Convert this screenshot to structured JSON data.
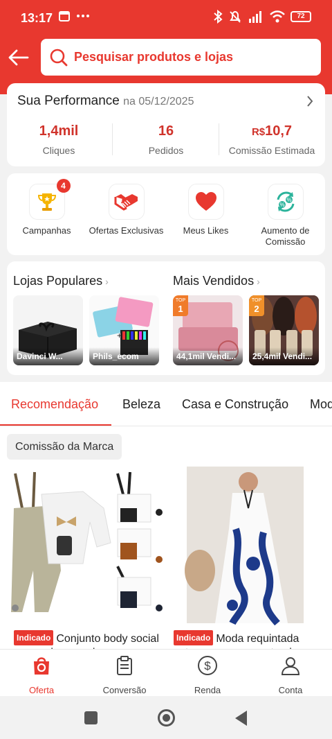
{
  "status_bar": {
    "time": "13:17",
    "battery": "72"
  },
  "search": {
    "placeholder": "Pesquisar produtos e lojas"
  },
  "performance": {
    "title": "Sua Performance",
    "date": "na 05/12/2025",
    "stats": [
      {
        "value": "1,4mil",
        "label": "Cliques"
      },
      {
        "value": "16",
        "label": "Pedidos"
      },
      {
        "currency": "R$",
        "value": "10,7",
        "label": "Comissão Estimada"
      }
    ]
  },
  "actions": [
    {
      "label": "Campanhas",
      "icon": "trophy-icon",
      "badge": "4"
    },
    {
      "label": "Ofertas Exclusivas",
      "icon": "handshake-icon"
    },
    {
      "label": "Meus Likes",
      "icon": "heart-icon"
    },
    {
      "label": "Aumento de Comissão",
      "icon": "percent-cycle-icon"
    }
  ],
  "popular_shops": {
    "title": "Lojas Populares",
    "items": [
      {
        "caption": "Davinci W..."
      },
      {
        "caption": "Phils_ecom"
      }
    ]
  },
  "best_sellers": {
    "title": "Mais Vendidos",
    "items": [
      {
        "top_label": "TOP",
        "rank": "1",
        "caption": "44,1mil Vendi..."
      },
      {
        "top_label": "TOP",
        "rank": "2",
        "caption": "25,4mil Vendi..."
      }
    ]
  },
  "tabs": [
    "Recomendação",
    "Beleza",
    "Casa e Construção",
    "Mod"
  ],
  "feed": {
    "chip": "Comissão da Marca",
    "products": [
      {
        "tag": "Indicado",
        "title": "Conjunto body social manga longa calca"
      },
      {
        "tag": "Indicado",
        "title": "Moda requintada estampa com gravata elea"
      }
    ]
  },
  "bottom_nav": [
    {
      "label": "Oferta",
      "icon": "offer-bag-icon",
      "active": true
    },
    {
      "label": "Conversão",
      "icon": "clipboard-icon"
    },
    {
      "label": "Renda",
      "icon": "dollar-circle-icon"
    },
    {
      "label": "Conta",
      "icon": "user-icon"
    }
  ],
  "colors": {
    "brand": "#e8382f",
    "value": "#d0332b"
  }
}
